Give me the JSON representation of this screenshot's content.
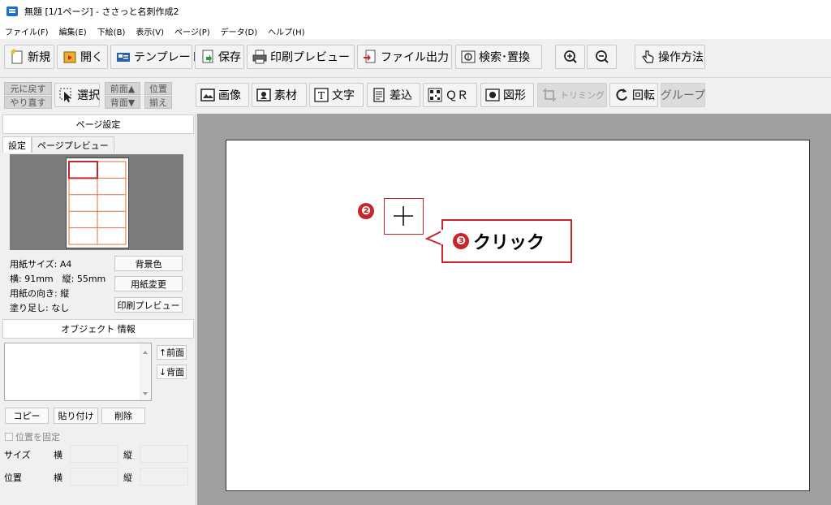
{
  "window": {
    "title": "無題 [1/1ページ] - ささっと名刺作成2"
  },
  "menu": [
    "ファイル(F)",
    "編集(E)",
    "下絵(B)",
    "表示(V)",
    "ページ(P)",
    "データ(D)",
    "ヘルプ(H)"
  ],
  "toolbar1": {
    "new": "新規",
    "open": "開く",
    "template": "テンプレート",
    "save": "保存",
    "print_preview": "印刷プレビュー",
    "file_output": "ファイル出力",
    "search_replace": "検索･置換",
    "how_to": "操作方法"
  },
  "toolbar2": {
    "undo": "元に戻す",
    "redo": "やり直す",
    "select": "選択",
    "front": "前面▲",
    "back": "背面▼",
    "align_1": "位置",
    "align_2": "揃え",
    "image": "画像",
    "material": "素材",
    "text": "文字",
    "insert": "差込",
    "qr": "ＱＲ",
    "shape": "図形",
    "trimming": "トリミング",
    "rotate": "回転",
    "group": "グループ"
  },
  "page_settings": {
    "header": "ページ設定",
    "tab_settings": "設定",
    "tab_preview": "ページプレビュー",
    "paper_size": "用紙サイズ: A4",
    "dimensions": "横: 91mm　縦: 55mm",
    "orientation": "用紙の向き: 縦",
    "bleed": "塗り足し: なし",
    "bg_color_btn": "背景色",
    "change_paper_btn": "用紙変更",
    "print_preview_btn": "印刷プレビュー"
  },
  "object_info": {
    "header": "オブジェクト 情報",
    "front_btn": "↑前面",
    "back_btn": "↓背面",
    "copy_btn": "コピー",
    "paste_btn": "貼り付け",
    "delete_btn": "削除",
    "fix_position": "位置を固定",
    "size_label": "サイズ",
    "position_label": "位置",
    "width_label": "横",
    "height_label": "縦"
  },
  "annotations": {
    "step2": "❷",
    "step3": "❸",
    "click_label": "クリック",
    "accent_color": "#c6262e"
  }
}
